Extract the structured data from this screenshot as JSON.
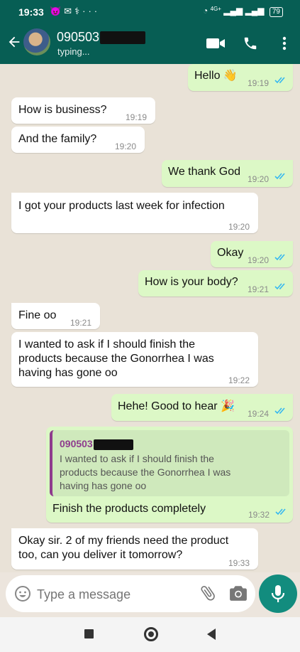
{
  "status_bar": {
    "time": "19:33",
    "battery": "79",
    "network": "4G+"
  },
  "header": {
    "contact_name": "090503",
    "contact_status": "typing..."
  },
  "messages": [
    {
      "dir": "out",
      "text": "Hello",
      "emoji": "👋",
      "time": "19:19",
      "read": true
    },
    {
      "dir": "in",
      "text": "How is business?",
      "time": "19:19"
    },
    {
      "dir": "in",
      "text": "And the family?",
      "time": "19:20"
    },
    {
      "dir": "out",
      "text": "We thank God",
      "time": "19:20",
      "read": true
    },
    {
      "dir": "in",
      "text": "I got your products last week for infection",
      "time": "19:20"
    },
    {
      "dir": "out",
      "text": "Okay",
      "time": "19:20",
      "read": true
    },
    {
      "dir": "out",
      "text": "How is your body?",
      "time": "19:21",
      "read": true
    },
    {
      "dir": "in",
      "text": "Fine oo",
      "time": "19:21"
    },
    {
      "dir": "in",
      "text": "I wanted to ask if I should finish the products because the Gonorrhea I was having has gone oo",
      "time": "19:22"
    },
    {
      "dir": "out",
      "text": "Hehe! Good to hear",
      "emoji": "🎉",
      "time": "19:24",
      "read": true
    },
    {
      "dir": "out",
      "text": "Finish the products completely",
      "time": "19:32",
      "read": true,
      "quote": {
        "name": "090503",
        "text": "I wanted to ask if I should finish the products because the Gonorrhea I was having has gone oo"
      }
    },
    {
      "dir": "in",
      "text": "Okay sir. 2 of my friends need the product too, can you deliver it tomorrow?",
      "time": "19:33"
    }
  ],
  "input": {
    "placeholder": "Type a message"
  },
  "icons": {
    "back": "back-arrow-icon",
    "video": "video-call-icon",
    "call": "phone-icon",
    "menu": "more-vert-icon",
    "emoji": "emoji-icon",
    "attach": "attach-icon",
    "camera": "camera-icon",
    "mic": "mic-icon"
  },
  "colors": {
    "header": "#075e54",
    "outgoing": "#dcf8c6",
    "incoming": "#ffffff",
    "read_ticks": "#34b7f1",
    "mic_button": "#128c7e"
  }
}
